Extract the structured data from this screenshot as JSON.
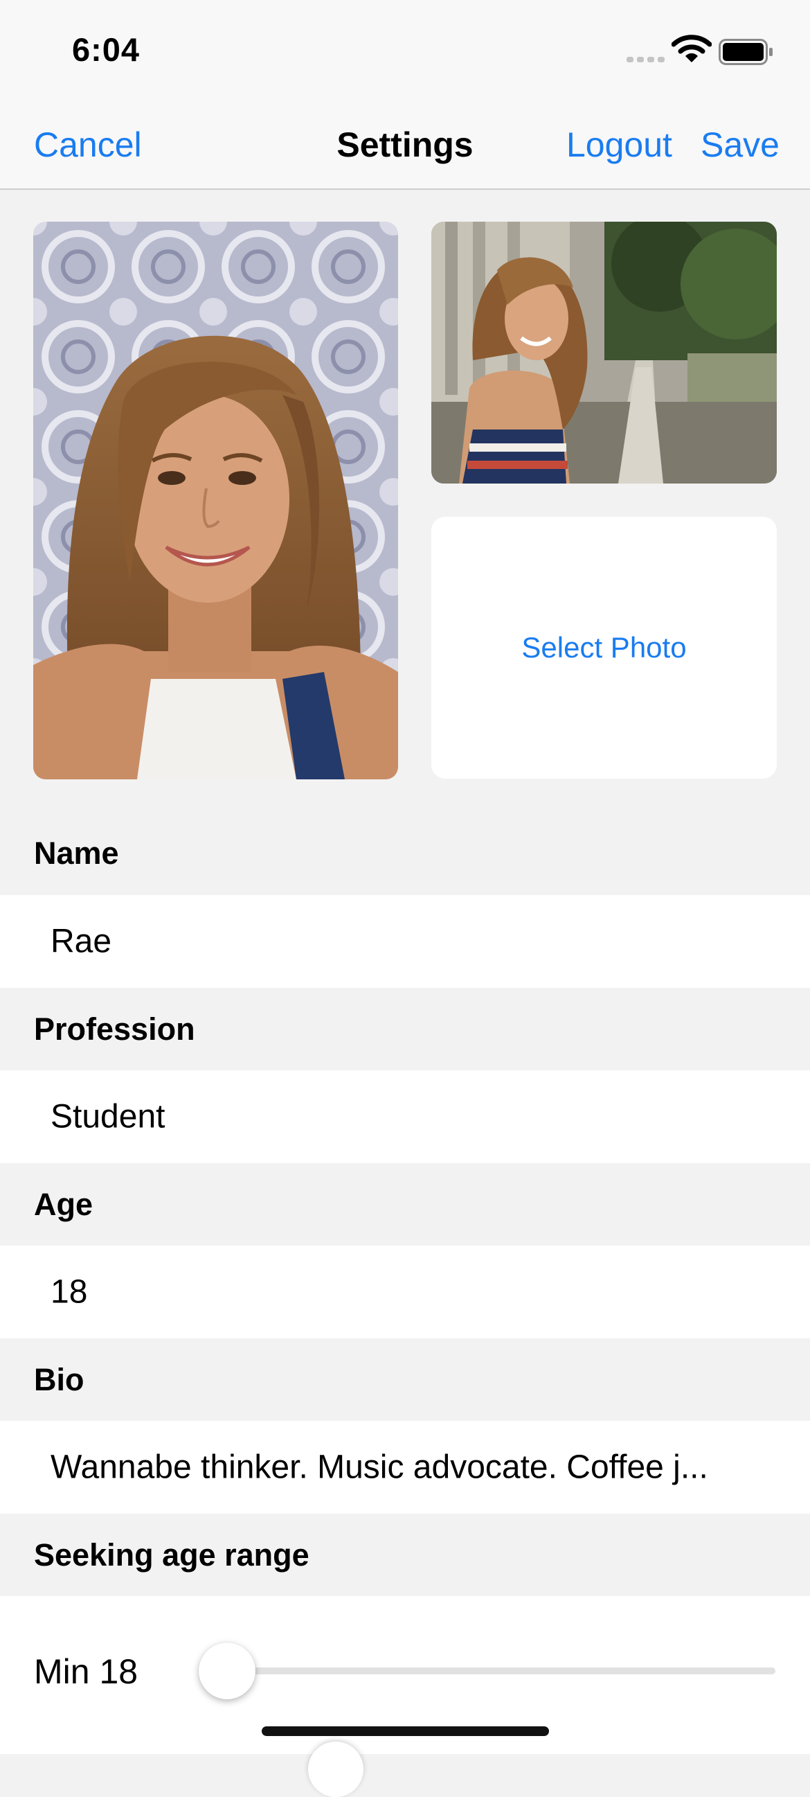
{
  "status_bar": {
    "time": "6:04",
    "icons": [
      "signal-icon",
      "wifi-icon",
      "battery-icon"
    ]
  },
  "nav": {
    "cancel_label": "Cancel",
    "title": "Settings",
    "logout_label": "Logout",
    "save_label": "Save"
  },
  "photos": {
    "select_photo_label": "Select Photo"
  },
  "form": {
    "name": {
      "header": "Name",
      "value": "Rae"
    },
    "profession": {
      "header": "Profession",
      "value": "Student"
    },
    "age": {
      "header": "Age",
      "value": "18"
    },
    "bio": {
      "header": "Bio",
      "value": "Wannabe thinker. Music advocate. Coffee j..."
    },
    "seeking_age_range": {
      "header": "Seeking age range"
    }
  },
  "age_range": {
    "min_label": "Min 18",
    "min_value": 18
  },
  "colors": {
    "accent": "#1a7cf0",
    "background": "#f2f2f2",
    "field_background": "#ffffff"
  }
}
